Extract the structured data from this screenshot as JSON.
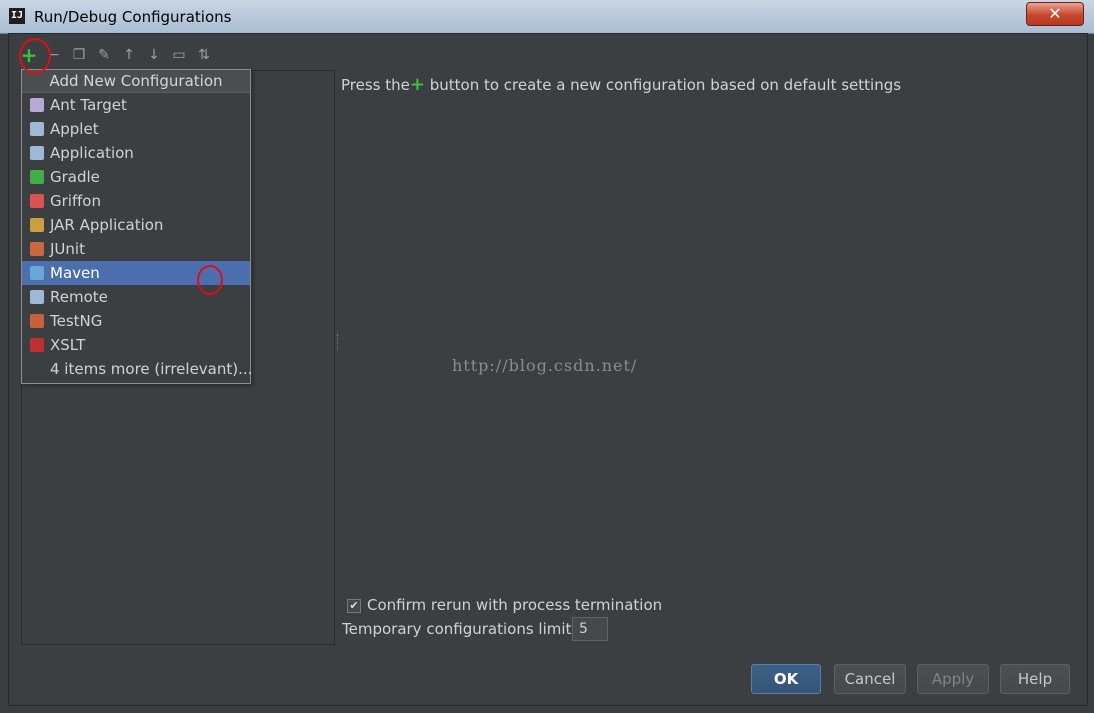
{
  "window": {
    "title": "Run/Debug Configurations",
    "close": "✕",
    "logo": "IJ"
  },
  "toolbar": [
    {
      "name": "add-icon",
      "glyph": "+"
    },
    {
      "name": "remove-icon",
      "glyph": "−"
    },
    {
      "name": "copy-icon",
      "glyph": "❐"
    },
    {
      "name": "edit-defaults-icon",
      "glyph": "✎"
    },
    {
      "name": "move-up-icon",
      "glyph": "↑"
    },
    {
      "name": "move-down-icon",
      "glyph": "↓"
    },
    {
      "name": "folder-icon",
      "glyph": "▭"
    },
    {
      "name": "sort-icon",
      "glyph": "⇅"
    }
  ],
  "popup": {
    "header": "Add New Configuration",
    "items": [
      {
        "label": "Ant Target",
        "icon": "ant-icon",
        "color": "#b9a7d8"
      },
      {
        "label": "Applet",
        "icon": "applet-icon",
        "color": "#9fb8d8"
      },
      {
        "label": "Application",
        "icon": "application-icon",
        "color": "#9fb8d8"
      },
      {
        "label": "Gradle",
        "icon": "gradle-icon",
        "color": "#3fae49"
      },
      {
        "label": "Griffon",
        "icon": "griffon-icon",
        "color": "#d9534f"
      },
      {
        "label": "JAR Application",
        "icon": "jar-icon",
        "color": "#c8a040"
      },
      {
        "label": "JUnit",
        "icon": "junit-icon",
        "color": "#c86840"
      },
      {
        "label": "Maven",
        "icon": "maven-icon",
        "color": "#6aa7d8",
        "selected": true
      },
      {
        "label": "Remote",
        "icon": "remote-icon",
        "color": "#9fb8d8"
      },
      {
        "label": "TestNG",
        "icon": "testng-icon",
        "color": "#c86040"
      },
      {
        "label": "XSLT",
        "icon": "xslt-icon",
        "color": "#c03030"
      },
      {
        "label": "4 items more (irrelevant)...",
        "icon": "",
        "color": ""
      }
    ]
  },
  "main": {
    "hint_prefix": "Press the",
    "hint_plus": "+",
    "hint_suffix": " button to create a new configuration based on default settings",
    "watermark": "http://blog.csdn.net/"
  },
  "options": {
    "confirm_rerun_label": "Confirm rerun with process termination",
    "confirm_rerun_checked": true,
    "temp_limit_label": "Temporary configurations limit:",
    "temp_limit_value": "5"
  },
  "buttons": {
    "ok": "OK",
    "cancel": "Cancel",
    "apply": "Apply",
    "help": "Help"
  }
}
